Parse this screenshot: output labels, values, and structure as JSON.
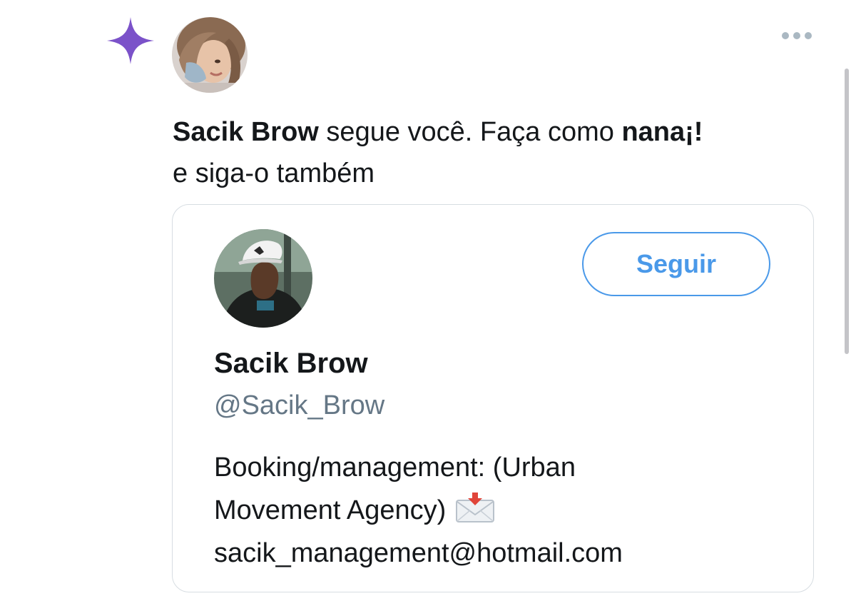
{
  "notification": {
    "actor_name": "Sacik Brow",
    "text_middle": " segue você. Faça como ",
    "friend_name": "nana¡!",
    "text_end": "e siga-o também",
    "icon": "sparkle-icon",
    "more_icon": "more-horizontal-icon"
  },
  "profile_card": {
    "display_name": "Sacik Brow",
    "handle": "@Sacik_Brow",
    "follow_label": "Seguir",
    "bio_line1": "Booking/management: (Urban",
    "bio_line2": "Movement Agency)",
    "bio_line3": "sacik_management@hotmail.com",
    "bio_icon": "envelope-icon"
  },
  "colors": {
    "accent": "#4a99e9",
    "sparkle": "#7b52c9",
    "secondary_text": "#657786",
    "border": "#d7dde2"
  }
}
